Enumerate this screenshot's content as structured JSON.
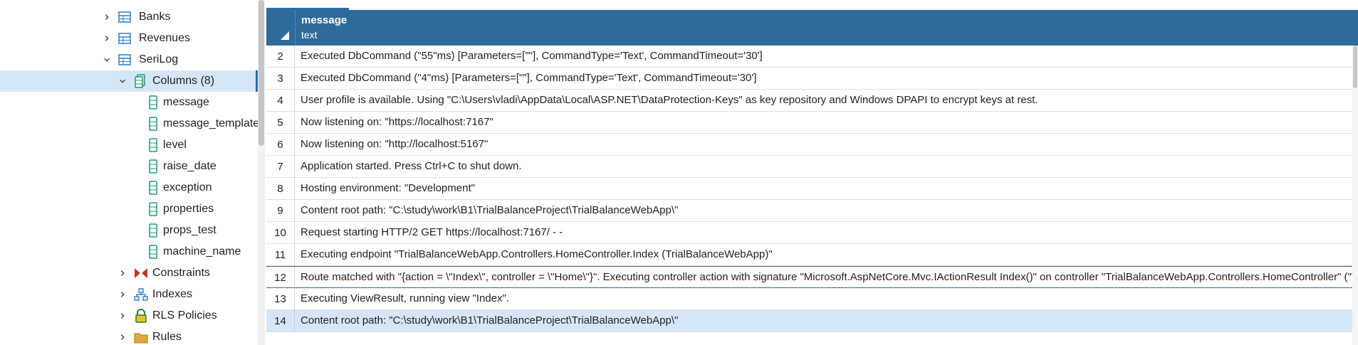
{
  "tree": {
    "items": [
      {
        "label": "Banks",
        "icon": "table-icon",
        "expanded": false
      },
      {
        "label": "Revenues",
        "icon": "table-icon",
        "expanded": false
      },
      {
        "label": "SeriLog",
        "icon": "table-icon",
        "expanded": true
      },
      {
        "label": "Columns (8)",
        "icon": "columns-icon",
        "expanded": true,
        "selected": true
      },
      {
        "label": "message",
        "icon": "column-icon"
      },
      {
        "label": "message_template",
        "icon": "column-icon"
      },
      {
        "label": "level",
        "icon": "column-icon"
      },
      {
        "label": "raise_date",
        "icon": "column-icon"
      },
      {
        "label": "exception",
        "icon": "column-icon"
      },
      {
        "label": "properties",
        "icon": "column-icon"
      },
      {
        "label": "props_test",
        "icon": "column-icon"
      },
      {
        "label": "machine_name",
        "icon": "column-icon"
      },
      {
        "label": "Constraints",
        "icon": "constraints-icon",
        "expanded": false
      },
      {
        "label": "Indexes",
        "icon": "indexes-icon",
        "expanded": false
      },
      {
        "label": "RLS Policies",
        "icon": "lock-icon",
        "expanded": false
      },
      {
        "label": "Rules",
        "icon": "rules-icon",
        "expanded": false
      }
    ]
  },
  "grid": {
    "column": {
      "name": "message",
      "type": "text"
    },
    "rows": [
      {
        "n": "2",
        "message": "Executed DbCommand (\"55\"ms) [Parameters=[\"\"], CommandType='Text', CommandTimeout='30']"
      },
      {
        "n": "3",
        "message": "Executed DbCommand (\"4\"ms) [Parameters=[\"\"], CommandType='Text', CommandTimeout='30']"
      },
      {
        "n": "4",
        "message": "User profile is available. Using \"C:\\Users\\vladi\\AppData\\Local\\ASP.NET\\DataProtection-Keys\" as key repository and Windows DPAPI to encrypt keys at rest."
      },
      {
        "n": "5",
        "message": "Now listening on: \"https://localhost:7167\""
      },
      {
        "n": "6",
        "message": "Now listening on: \"http://localhost:5167\""
      },
      {
        "n": "7",
        "message": "Application started. Press Ctrl+C to shut down."
      },
      {
        "n": "8",
        "message": "Hosting environment: \"Development\""
      },
      {
        "n": "9",
        "message": "Content root path: \"C:\\study\\work\\B1\\TrialBalanceProject\\TrialBalanceWebApp\\\""
      },
      {
        "n": "10",
        "message": "Request starting HTTP/2 GET https://localhost:7167/ - -"
      },
      {
        "n": "11",
        "message": "Executing endpoint \"TrialBalanceWebApp.Controllers.HomeController.Index (TrialBalanceWebApp)\""
      },
      {
        "n": "12",
        "message": "Route matched with \"{action = \\\"Index\\\", controller = \\\"Home\\\"}\". Executing controller action with signature \"Microsoft.AspNetCore.Mvc.IActionResult Index()\" on controller \"TrialBalanceWebApp.Controllers.HomeController\" (\"T"
      },
      {
        "n": "13",
        "message": "Executing ViewResult, running view \"Index\"."
      },
      {
        "n": "14",
        "message": "Content root path: \"C:\\study\\work\\B1\\TrialBalanceProject\\TrialBalanceWebApp\\\""
      }
    ]
  },
  "colors": {
    "header_bg": "#2e6a9a",
    "selection_bg": "#d5e7f7",
    "table_icon": "#2b7bc4",
    "column_icon": "#1e9a6e"
  }
}
